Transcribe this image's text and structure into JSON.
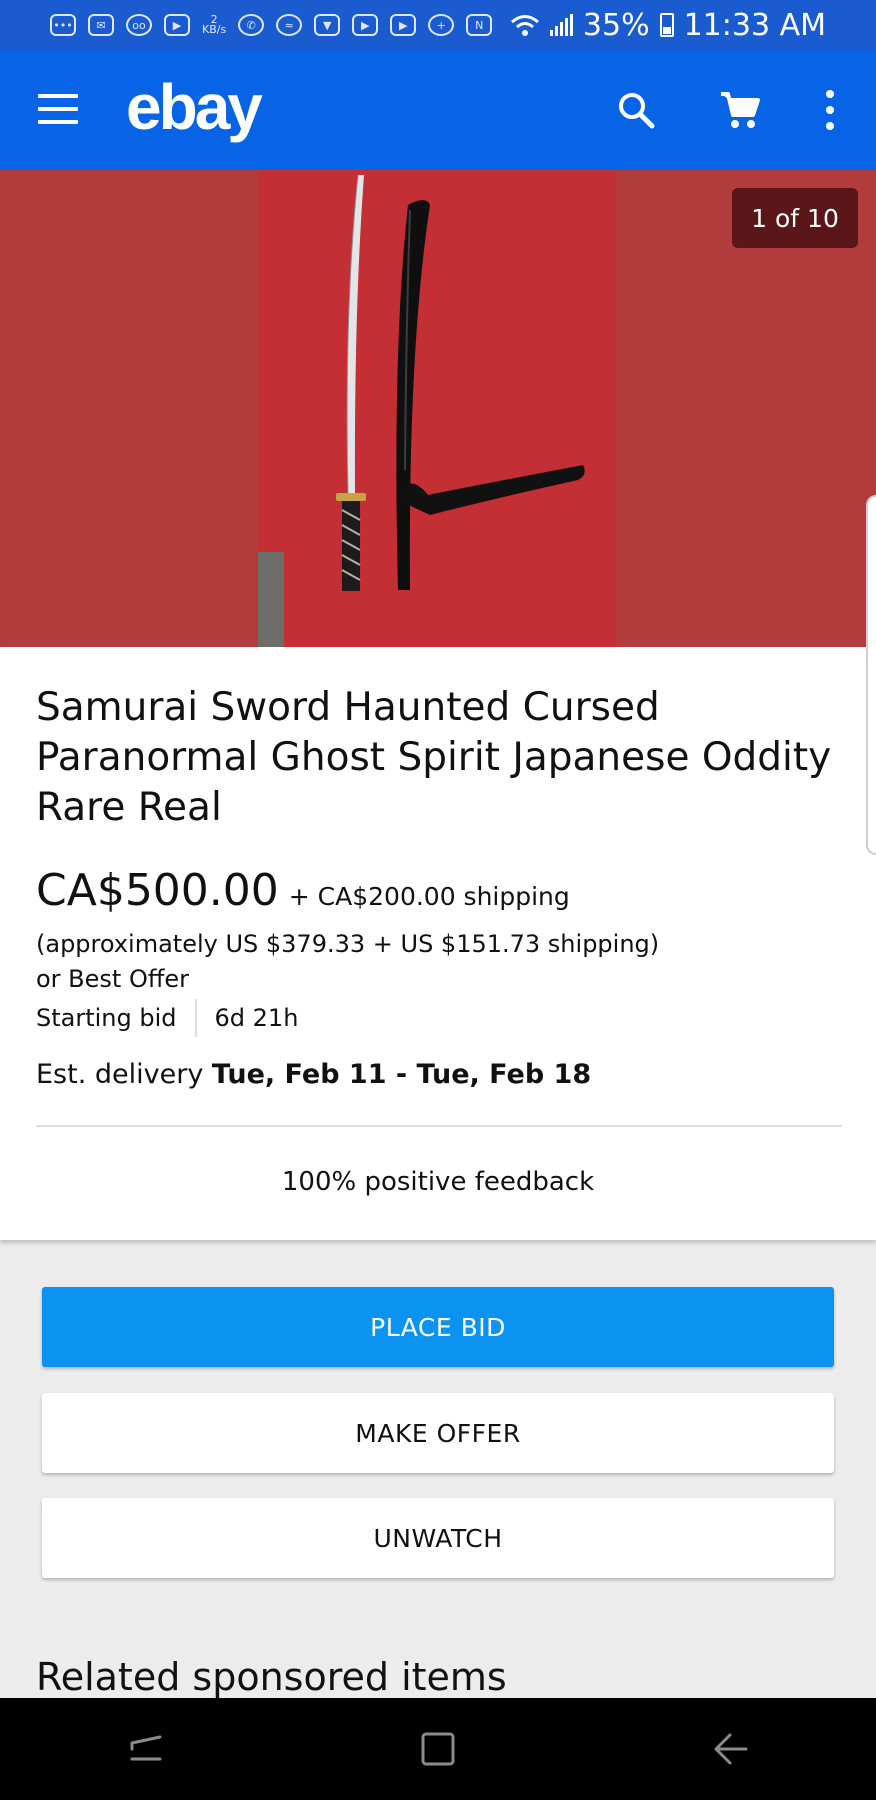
{
  "status_bar": {
    "speed_value": "2",
    "speed_unit": "KB/s",
    "battery_level": "35%",
    "time": "11:33 AM"
  },
  "app_bar": {
    "logo": "ebay",
    "icons": [
      "menu-icon",
      "search-icon",
      "cart-icon",
      "more-vert-icon"
    ]
  },
  "gallery": {
    "counter": "1 of 10"
  },
  "item": {
    "title": "Samurai Sword Haunted Cursed Paranormal Ghost Spirit Japanese Oddity Rare Real",
    "price": "CA$500.00",
    "shipping": "+ CA$200.00 shipping",
    "approx": "(approximately US $379.33 + US $151.73 shipping)",
    "best_offer": "or Best Offer",
    "bid_type": "Starting bid",
    "time_left": "6d 21h",
    "delivery_label": "Est. delivery",
    "delivery_dates": "Tue, Feb 11 - Tue, Feb 18",
    "feedback": "100% positive feedback"
  },
  "actions": {
    "place_bid": "PLACE BID",
    "make_offer": "MAKE OFFER",
    "unwatch": "UNWATCH"
  },
  "related": {
    "heading": "Related sponsored items"
  },
  "colors": {
    "app_bar": "#0864e6",
    "status_bar": "#1b5bd0",
    "primary_button": "#0a93f1",
    "photo_background": "#b23b3b"
  }
}
